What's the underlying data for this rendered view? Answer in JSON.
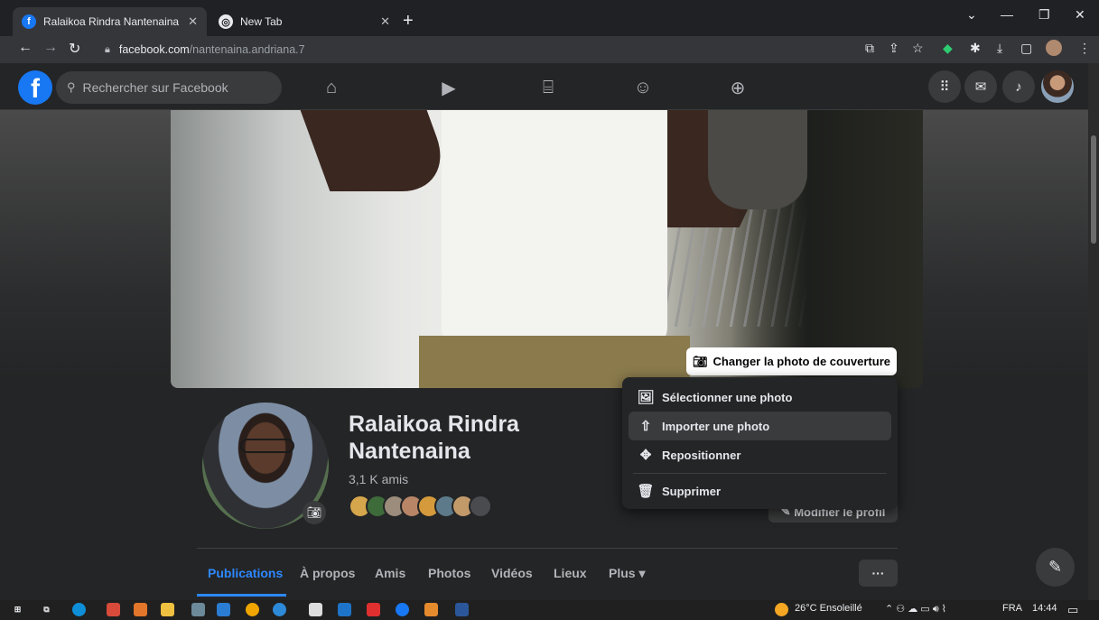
{
  "browser": {
    "tabs": [
      {
        "title": "Ralaikoa Rindra Nantenaina | Fac",
        "icon": "facebook-icon",
        "active": true
      },
      {
        "title": "New Tab",
        "icon": "chrome-icon",
        "active": false
      }
    ],
    "url_domain": "facebook.com",
    "url_path": "/nantenaina.andriana.7"
  },
  "facebook": {
    "search_placeholder": "Rechercher sur Facebook",
    "nav_icons": [
      "home-icon",
      "watch-icon",
      "marketplace-icon",
      "groups-icon",
      "gaming-icon"
    ]
  },
  "cover": {
    "change_label": "Changer la photo de couverture"
  },
  "cover_menu": {
    "items": [
      {
        "label": "Sélectionner une photo",
        "icon": "photo-select-icon"
      },
      {
        "label": "Importer une photo",
        "icon": "upload-icon"
      },
      {
        "label": "Repositionner",
        "icon": "move-icon"
      },
      {
        "label": "Supprimer",
        "icon": "trash-icon"
      }
    ]
  },
  "profile": {
    "name": "Ralaikoa Rindra Nantenaina",
    "friends": "3,1 K amis",
    "edit_label": "Modifier le profil"
  },
  "profile_tabs": [
    "Publications",
    "À propos",
    "Amis",
    "Photos",
    "Vidéos",
    "Lieux",
    "Plus ▾"
  ],
  "more_label": "···",
  "taskbar": {
    "weather": "26°C Ensoleillé",
    "lang": "FRA",
    "time": "14:44"
  },
  "colors": {
    "facebook_blue": "#1877f2",
    "active_tab": "#2d88ff",
    "surface": "#242526"
  }
}
